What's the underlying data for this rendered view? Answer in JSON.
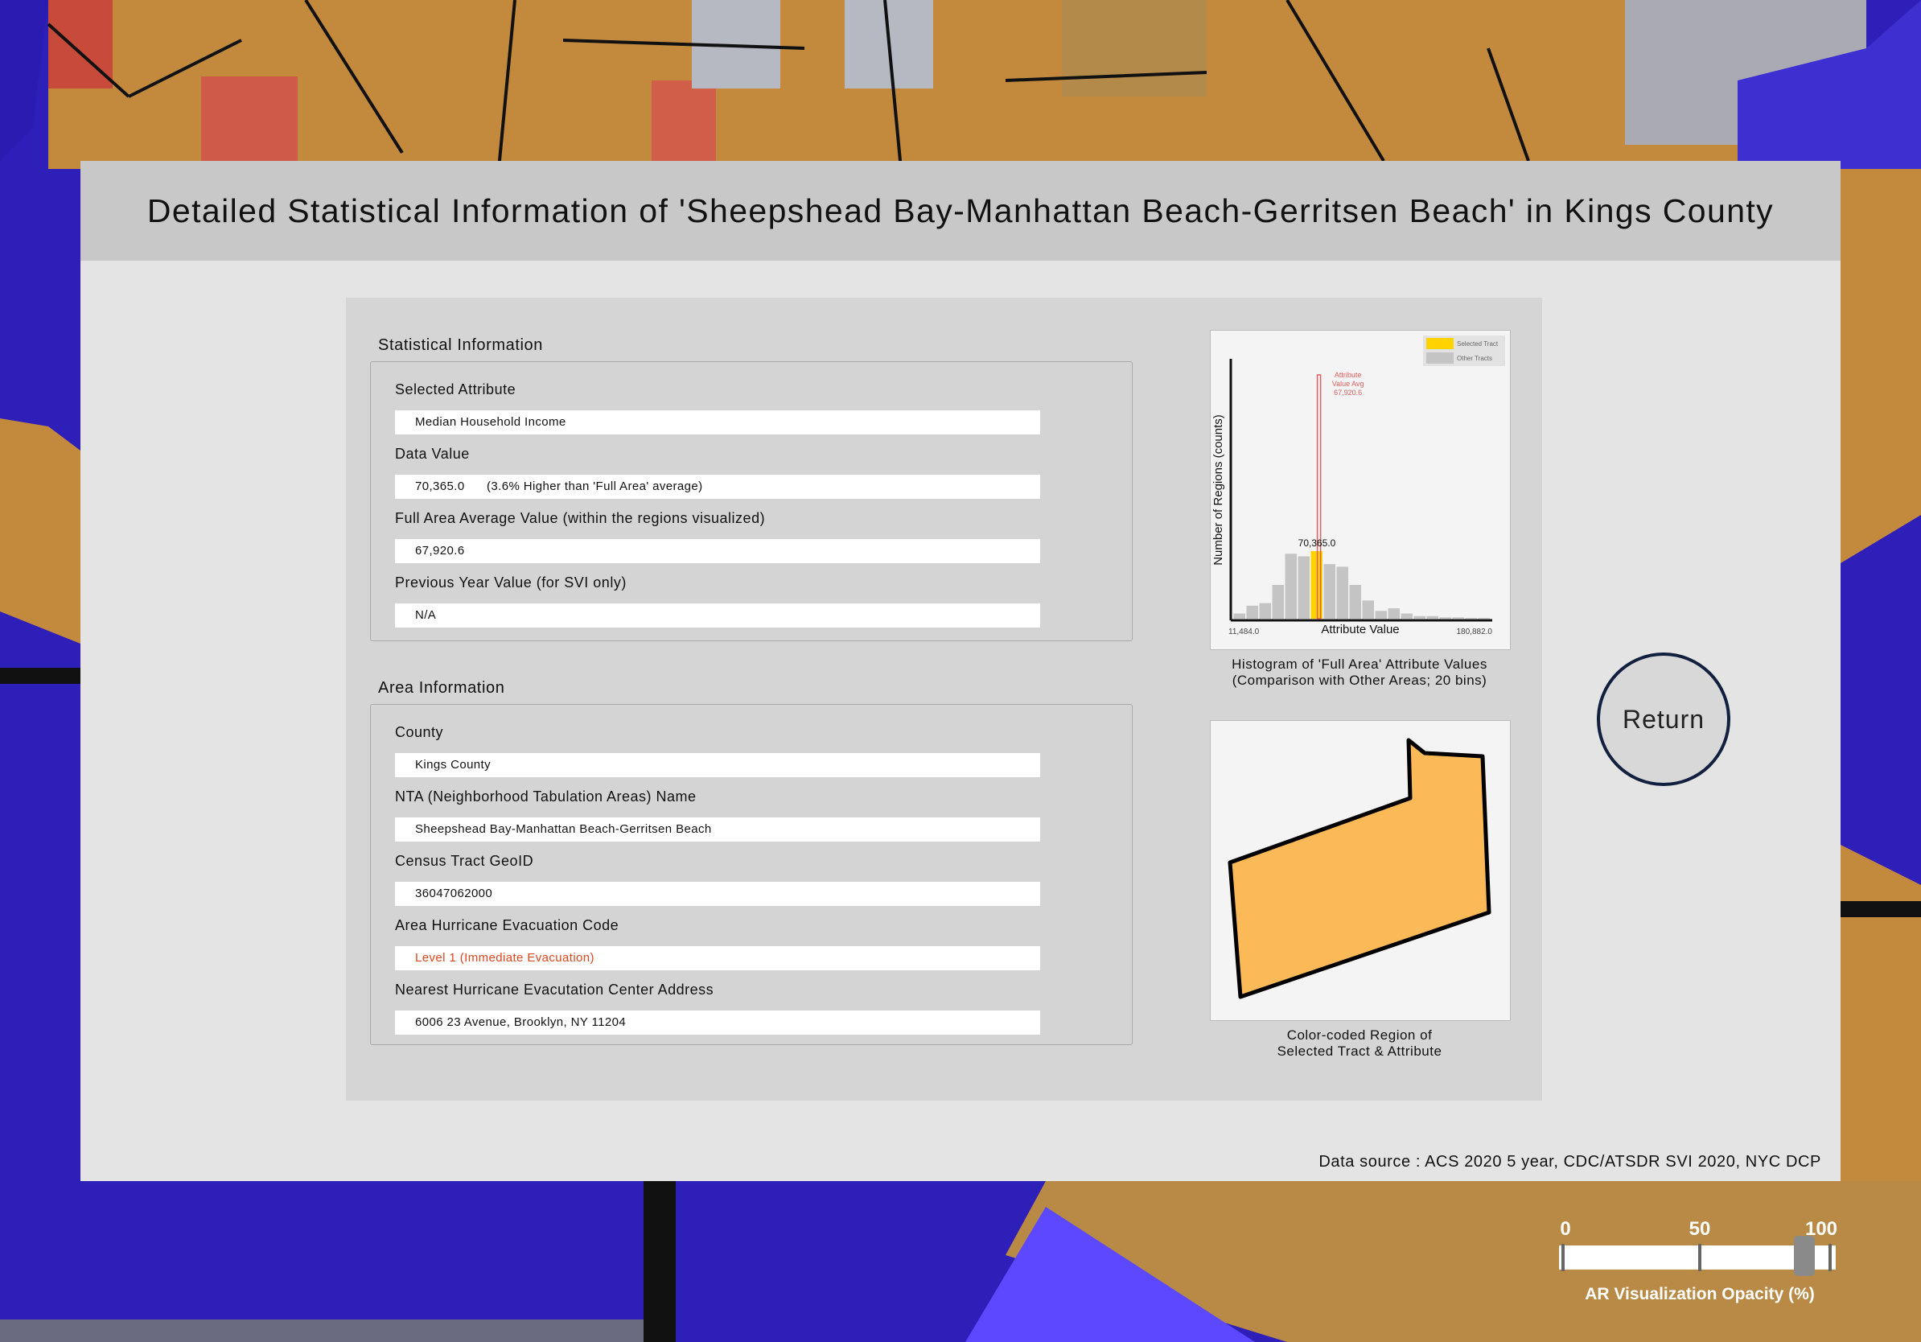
{
  "header": {
    "title": "Detailed Statistical Information of 'Sheepshead Bay-Manhattan Beach-Gerritsen Beach' in Kings County"
  },
  "statistical_info": {
    "section_title": "Statistical Information",
    "fields": [
      {
        "label": "Selected Attribute",
        "value": "Median Household Income"
      },
      {
        "label": "Data Value",
        "value": "70,365.0      (3.6% Higher than 'Full Area' average)"
      },
      {
        "label": "Full Area Average Value (within the regions visualized)",
        "value": "67,920.6"
      },
      {
        "label": "Previous Year Value (for SVI only)",
        "value": "N/A"
      }
    ]
  },
  "area_info": {
    "section_title": "Area Information",
    "fields": [
      {
        "label": "County",
        "value": "Kings County"
      },
      {
        "label": "NTA (Neighborhood Tabulation Areas) Name",
        "value": "Sheepshead Bay-Manhattan Beach-Gerritsen Beach"
      },
      {
        "label": "Census Tract GeoID",
        "value": "36047062000"
      },
      {
        "label": "Area Hurricane Evacuation Code",
        "value": "Level 1 (Immediate Evacuation)"
      },
      {
        "label": "Nearest Hurricane Evacutation Center Address",
        "value": "6006 23 Avenue, Brooklyn, NY 11204"
      }
    ]
  },
  "histogram_caption": {
    "line1": "Histogram of 'Full Area' Attribute Values",
    "line2": "(Comparison with Other Areas; 20 bins)"
  },
  "region_caption": {
    "line1": "Color-coded Region of",
    "line2": "Selected Tract & Attribute"
  },
  "return_button": {
    "label": "Return"
  },
  "data_source": "Data source : ACS 2020 5 year, CDC/ATSDR SVI 2020, NYC DCP",
  "opacity_slider": {
    "ticks": [
      "0",
      "50",
      "100"
    ],
    "value_percent": 90,
    "caption": "AR Visualization Opacity (%)"
  },
  "colors": {
    "selected_bar": "#ffd200",
    "other_bar": "#c4c4c4",
    "avg_line": "#e36060",
    "region_fill": "#fbb957",
    "alert_text": "#e0461e"
  },
  "chart_data": {
    "type": "bar",
    "title": "",
    "xlabel": "Attribute Value",
    "ylabel": "Number of Regions (counts)",
    "x_min_label": "11,484.0",
    "x_max_label": "180,882.0",
    "xlim": [
      11484.0,
      180882.0
    ],
    "bins": 20,
    "values": [
      2,
      5,
      6,
      13,
      25,
      24,
      26,
      21,
      20,
      13,
      7,
      3,
      4,
      2,
      1,
      1,
      0.5,
      0.5,
      0.3,
      0.3
    ],
    "selected_bin": 6,
    "selected_label": "70,365.0",
    "selected_value": 70365.0,
    "average": 67920.6,
    "average_label_lines": [
      "Attribute",
      "Value Avg",
      "67,920.6"
    ],
    "legend": [
      {
        "name": "Selected Tract",
        "color": "#ffd200"
      },
      {
        "name": "Other Tracts",
        "color": "#c4c4c4"
      }
    ],
    "legend_position": "top-right"
  }
}
